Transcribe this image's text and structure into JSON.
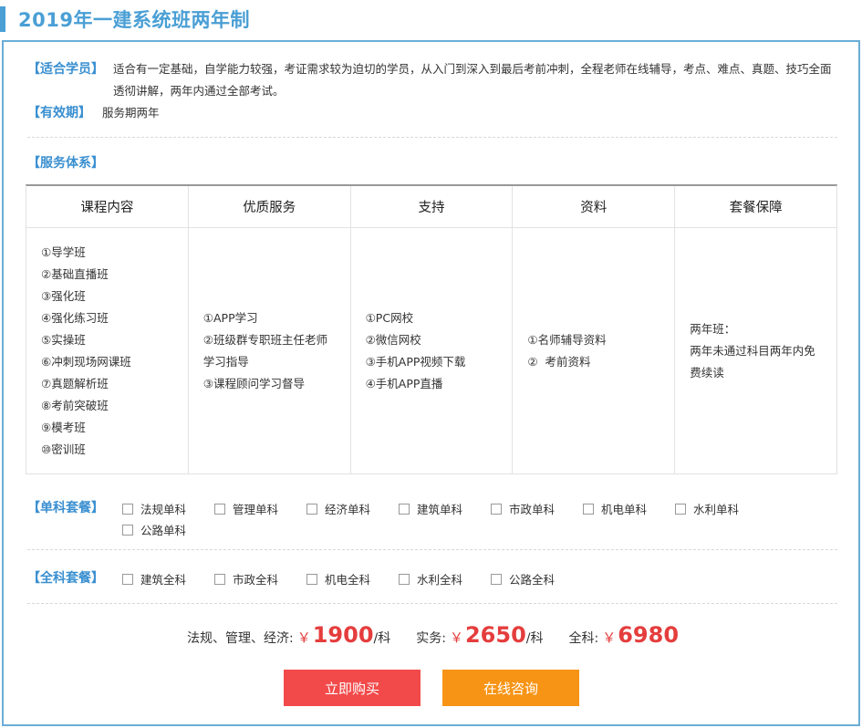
{
  "page_title": "2019年一建系统班两年制",
  "suitable": {
    "label": "【适合学员】",
    "text": "适合有一定基础，自学能力较强，考证需求较为迫切的学员，从入门到深入到最后考前冲刺，全程老师在线辅导，考点、难点、真题、技巧全面透彻讲解，两年内通过全部考试。"
  },
  "validity": {
    "label": "【有效期】",
    "text": "服务期两年"
  },
  "service": {
    "label": "【服务体系】",
    "columns": [
      {
        "header": "课程内容",
        "items": [
          "①导学班",
          "②基础直播班",
          "③强化班",
          "④强化练习班",
          "⑤实操班",
          "⑥冲刺现场网课班",
          "⑦真题解析班",
          "⑧考前突破班",
          "⑨模考班",
          "⑩密训班"
        ]
      },
      {
        "header": "优质服务",
        "items": [
          "①APP学习",
          "②班级群专职班主任老师学习指导",
          "③课程顾问学习督导"
        ]
      },
      {
        "header": "支持",
        "items": [
          "①PC网校",
          "②微信网校",
          "③手机APP视频下载",
          "④手机APP直播"
        ]
      },
      {
        "header": "资料",
        "items": [
          "①名师辅导资料",
          "②  考前资料"
        ]
      },
      {
        "header": "套餐保障",
        "items": [
          "两年班：",
          "两年未通过科目两年内免费续读"
        ]
      }
    ]
  },
  "single_package": {
    "label": "【单科套餐】",
    "options": [
      "法规单科",
      "管理单科",
      "经济单科",
      "建筑单科",
      "市政单科",
      "机电单科",
      "水利单科",
      "公路单科"
    ]
  },
  "full_package": {
    "label": "【全科套餐】",
    "options": [
      "建筑全科",
      "市政全科",
      "机电全科",
      "水利全科",
      "公路全科"
    ]
  },
  "prices": {
    "group1_label": "法规、管理、经济:",
    "group1_price": "1900",
    "group2_label": "实务:",
    "group2_price": "2650",
    "group3_label": "全科:",
    "group3_price": "6980",
    "currency": "￥",
    "unit": "/科"
  },
  "buttons": {
    "buy": "立即购买",
    "consult": "在线咨询"
  },
  "colors": {
    "accent": "#4a9fd5",
    "price": "#e53d3d",
    "buy": "#f24a4a",
    "consult": "#f79416"
  }
}
